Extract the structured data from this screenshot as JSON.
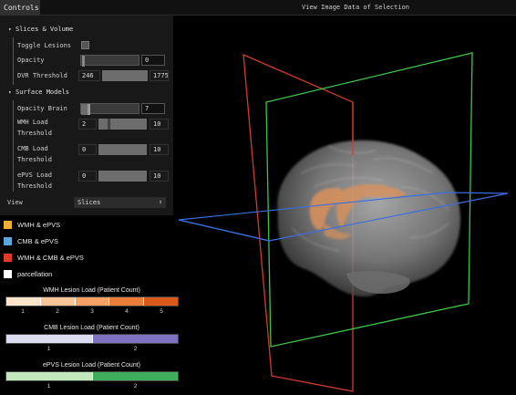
{
  "topbar": {
    "controls_tab": "Controls",
    "title": "View Image Data of Selection"
  },
  "controls": {
    "slices_volume": {
      "title": "Slices & Volume",
      "toggle_lesions_label": "Toggle Lesions",
      "opacity_label": "Opacity",
      "opacity_value": "0",
      "dvr_threshold_label": "DVR Threshold",
      "dvr_threshold_min": "246",
      "dvr_threshold_max": "1775"
    },
    "surface_models": {
      "title": "Surface Models",
      "opacity_brain_label": "Opacity Brain",
      "opacity_brain_value": "7",
      "wmh_load_label_line1": "WMH Load",
      "wmh_load_label_line2": "Threshold",
      "wmh_load_min": "2",
      "wmh_load_max": "10",
      "cmb_load_label_line1": "CMB Load",
      "cmb_load_label_line2": "Threshold",
      "cmb_load_min": "0",
      "cmb_load_max": "10",
      "epvs_load_label_line1": "ePVS Load",
      "epvs_load_label_line2": "Threshold",
      "epvs_load_min": "0",
      "epvs_load_max": "10"
    },
    "view": {
      "label": "View",
      "selected": "Slices",
      "arrow": "⇕"
    }
  },
  "legend": [
    {
      "label": "WMH & ePVS",
      "color": "#f0b030"
    },
    {
      "label": "CMB & ePVS",
      "color": "#5aa7e0"
    },
    {
      "label": "WMH & CMB & ePVS",
      "color": "#e03a2a"
    },
    {
      "label": "parcellation",
      "color": "#ffffff"
    }
  ],
  "colorbars": [
    {
      "title": "WMH Lesion Load (Patient Count)",
      "colors": [
        "#fde5cc",
        "#fbc598",
        "#f6a163",
        "#ec7c3a",
        "#d95a1a"
      ],
      "ticks": [
        "1",
        "2",
        "3",
        "4",
        "5"
      ]
    },
    {
      "title": "CMB Lesion Load (Patient Count)",
      "colors": [
        "#dcdcf0",
        "#7f72c0"
      ],
      "ticks": [
        "1",
        "2"
      ]
    },
    {
      "title": "ePVS Lesion Load (Patient Count)",
      "colors": [
        "#c4e8bd",
        "#3fae5a"
      ],
      "ticks": [
        "1",
        "2"
      ]
    }
  ],
  "viewport_colors": {
    "sagittal_plane": "#d23a2f",
    "coronal_plane": "#3fc24a",
    "axial_plane": "#3a6ee0",
    "brain_surface": "#8a8a8a",
    "lesion_overlay": "#d9905a"
  }
}
